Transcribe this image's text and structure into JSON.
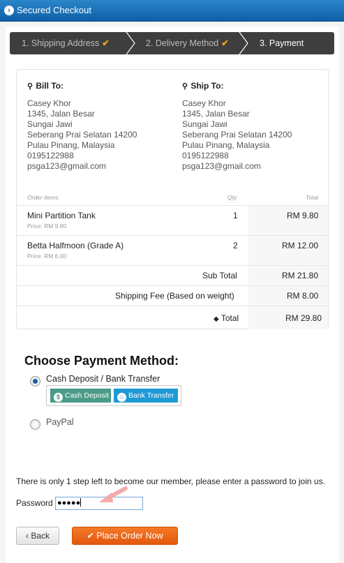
{
  "window": {
    "title": "Secured Checkout"
  },
  "steps": [
    {
      "label": "1. Shipping Address",
      "done": true
    },
    {
      "label": "2. Delivery Method",
      "done": true
    },
    {
      "label": "3. Payment",
      "done": false
    }
  ],
  "bill_to": {
    "heading": "Bill To:",
    "name": "Casey Khor",
    "line1": "1345, Jalan Besar",
    "line2": "Sungai Jawi",
    "line3": "Seberang Prai Selatan 14200",
    "line4": "Pulau Pinang, Malaysia",
    "phone": "0195122988",
    "email": "psga123@gmail.com"
  },
  "ship_to": {
    "heading": "Ship To:",
    "name": "Casey Khor",
    "line1": "1345, Jalan Besar",
    "line2": "Sungai Jawi",
    "line3": "Seberang Prai Selatan 14200",
    "line4": "Pulau Pinang, Malaysia",
    "phone": "0195122988",
    "email": "psga123@gmail.com"
  },
  "order": {
    "headers": {
      "item": "Order Items",
      "qty": "Qty",
      "total": "Total"
    },
    "items": [
      {
        "name": "Mini Partition Tank",
        "price": "Price: RM 9.80",
        "qty": "1",
        "total": "RM 9.80"
      },
      {
        "name": "Betta Halfmoon (Grade A)",
        "price": "Price: RM 6.00",
        "qty": "2",
        "total": "RM 12.00"
      }
    ],
    "subtotal_label": "Sub Total",
    "subtotal": "RM 21.80",
    "shipping_label": "Shipping Fee (Based on weight)",
    "shipping": "RM 8.00",
    "total_label": "Total",
    "total": "RM 29.80"
  },
  "payment": {
    "heading": "Choose Payment Method:",
    "options": [
      {
        "label": "Cash Deposit / Bank Transfer",
        "selected": true
      },
      {
        "label": "PayPal",
        "selected": false
      }
    ],
    "badges": [
      {
        "label": "Cash Deposit",
        "icon": "dollar-icon",
        "color": "#4a9b87"
      },
      {
        "label": "Bank Transfer",
        "icon": "bank-icon",
        "color": "#1e9ad6"
      }
    ]
  },
  "member": {
    "note": "There is only 1 step left to become our member, please enter a password to join us.",
    "password_label": "Password",
    "password_mask": "●●●●●"
  },
  "buttons": {
    "back": "Back",
    "place_order": "Place Order Now"
  },
  "colors": {
    "accent": "#f47a27",
    "header_blue": "#1a6fb3",
    "stepbar": "#3e3e3e",
    "check": "#f7a31c"
  }
}
